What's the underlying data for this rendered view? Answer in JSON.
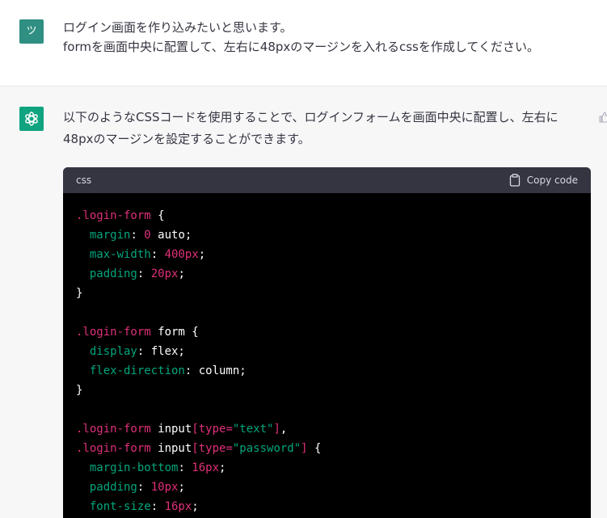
{
  "user": {
    "avatar_initial": "ツ",
    "line1": "ログイン画面を作り込みたいと思います。",
    "line2": "formを画面中央に配置して、左右に48pxのマージンを入れるcssを作成してください。"
  },
  "assistant": {
    "line1": "以下のようなCSSコードを使用することで、ログインフォームを画面中央に配置し、左右に",
    "line2": "48pxのマージンを設定することができます。"
  },
  "code": {
    "language": "css",
    "copy_label": "Copy code",
    "lines": [
      [
        {
          "t": ".login-form",
          "c": "sel"
        },
        {
          "t": " {",
          "c": "plain"
        }
      ],
      [
        {
          "t": "  margin",
          "c": "prop"
        },
        {
          "t": ": ",
          "c": "plain"
        },
        {
          "t": "0",
          "c": "num"
        },
        {
          "t": " auto;",
          "c": "plain"
        }
      ],
      [
        {
          "t": "  max-width",
          "c": "prop"
        },
        {
          "t": ": ",
          "c": "plain"
        },
        {
          "t": "400px",
          "c": "num"
        },
        {
          "t": ";",
          "c": "plain"
        }
      ],
      [
        {
          "t": "  padding",
          "c": "prop"
        },
        {
          "t": ": ",
          "c": "plain"
        },
        {
          "t": "20px",
          "c": "num"
        },
        {
          "t": ";",
          "c": "plain"
        }
      ],
      [
        {
          "t": "}",
          "c": "plain"
        }
      ],
      [],
      [
        {
          "t": ".login-form",
          "c": "sel"
        },
        {
          "t": " form {",
          "c": "plain"
        }
      ],
      [
        {
          "t": "  display",
          "c": "prop"
        },
        {
          "t": ": flex;",
          "c": "plain"
        }
      ],
      [
        {
          "t": "  flex-direction",
          "c": "prop"
        },
        {
          "t": ": column;",
          "c": "plain"
        }
      ],
      [
        {
          "t": "}",
          "c": "plain"
        }
      ],
      [],
      [
        {
          "t": ".login-form",
          "c": "sel"
        },
        {
          "t": " input",
          "c": "plain"
        },
        {
          "t": "[type=",
          "c": "sel"
        },
        {
          "t": "\"text\"",
          "c": "str"
        },
        {
          "t": "]",
          "c": "sel"
        },
        {
          "t": ",",
          "c": "plain"
        }
      ],
      [
        {
          "t": ".login-form",
          "c": "sel"
        },
        {
          "t": " input",
          "c": "plain"
        },
        {
          "t": "[type=",
          "c": "sel"
        },
        {
          "t": "\"password\"",
          "c": "str"
        },
        {
          "t": "]",
          "c": "sel"
        },
        {
          "t": " {",
          "c": "plain"
        }
      ],
      [
        {
          "t": "  margin-bottom",
          "c": "prop"
        },
        {
          "t": ": ",
          "c": "plain"
        },
        {
          "t": "16px",
          "c": "num"
        },
        {
          "t": ";",
          "c": "plain"
        }
      ],
      [
        {
          "t": "  padding",
          "c": "prop"
        },
        {
          "t": ": ",
          "c": "plain"
        },
        {
          "t": "10px",
          "c": "num"
        },
        {
          "t": ";",
          "c": "plain"
        }
      ],
      [
        {
          "t": "  font-size",
          "c": "prop"
        },
        {
          "t": ": ",
          "c": "plain"
        },
        {
          "t": "16px",
          "c": "num"
        },
        {
          "t": ";",
          "c": "plain"
        }
      ]
    ]
  }
}
